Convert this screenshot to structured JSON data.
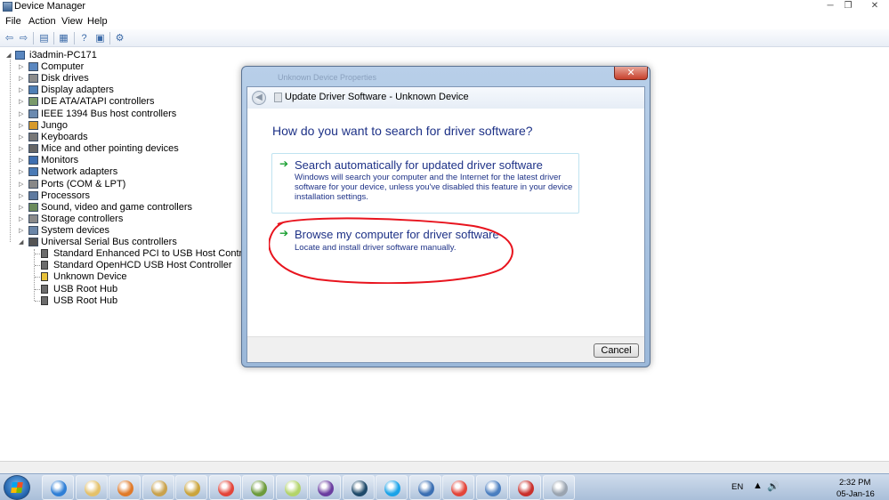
{
  "window": {
    "title": "Device Manager",
    "controls": {
      "minimize": "─",
      "maximize": "❐",
      "close": "✕"
    }
  },
  "menu": [
    "File",
    "Action",
    "View",
    "Help"
  ],
  "tree": {
    "root": "i3admin-PC171",
    "categories": [
      "Computer",
      "Disk drives",
      "Display adapters",
      "IDE ATA/ATAPI controllers",
      "IEEE 1394 Bus host controllers",
      "Jungo",
      "Keyboards",
      "Mice and other pointing devices",
      "Monitors",
      "Network adapters",
      "Ports (COM & LPT)",
      "Processors",
      "Sound, video and game controllers",
      "Storage controllers",
      "System devices",
      "Universal Serial Bus controllers"
    ],
    "usb_children": [
      "Standard Enhanced PCI to USB Host Controller",
      "Standard OpenHCD USB Host Controller",
      "Unknown Device",
      "USB Root Hub",
      "USB Root Hub"
    ]
  },
  "dialog": {
    "behind_title": "Unknown Device Properties",
    "close": "✕",
    "header_title": "Update Driver Software - Unknown Device",
    "question": "How do you want to search for driver software?",
    "option_auto": {
      "title": "Search automatically for updated driver software",
      "desc": "Windows will search your computer and the Internet for the latest driver software for your device, unless you've disabled this feature in your device installation settings."
    },
    "option_browse": {
      "title": "Browse my computer for driver software",
      "desc": "Locate and install driver software manually."
    },
    "cancel": "Cancel",
    "arrow": "➔",
    "back": "◀"
  },
  "colors": {
    "link_blue": "#1e3287",
    "annotation_red": "#e8141e",
    "arrow_green": "#1aa032"
  },
  "taskbar": {
    "apps": [
      "internet-explorer",
      "file-explorer",
      "media-player",
      "paint",
      "toolbox",
      "chrome",
      "tools",
      "folder",
      "music",
      "app",
      "skype",
      "thunderbird",
      "chrome",
      "control-panel",
      "toolkit",
      "usb-device"
    ],
    "language": "EN",
    "time": "2:32 PM",
    "date": "05-Jan-16"
  }
}
